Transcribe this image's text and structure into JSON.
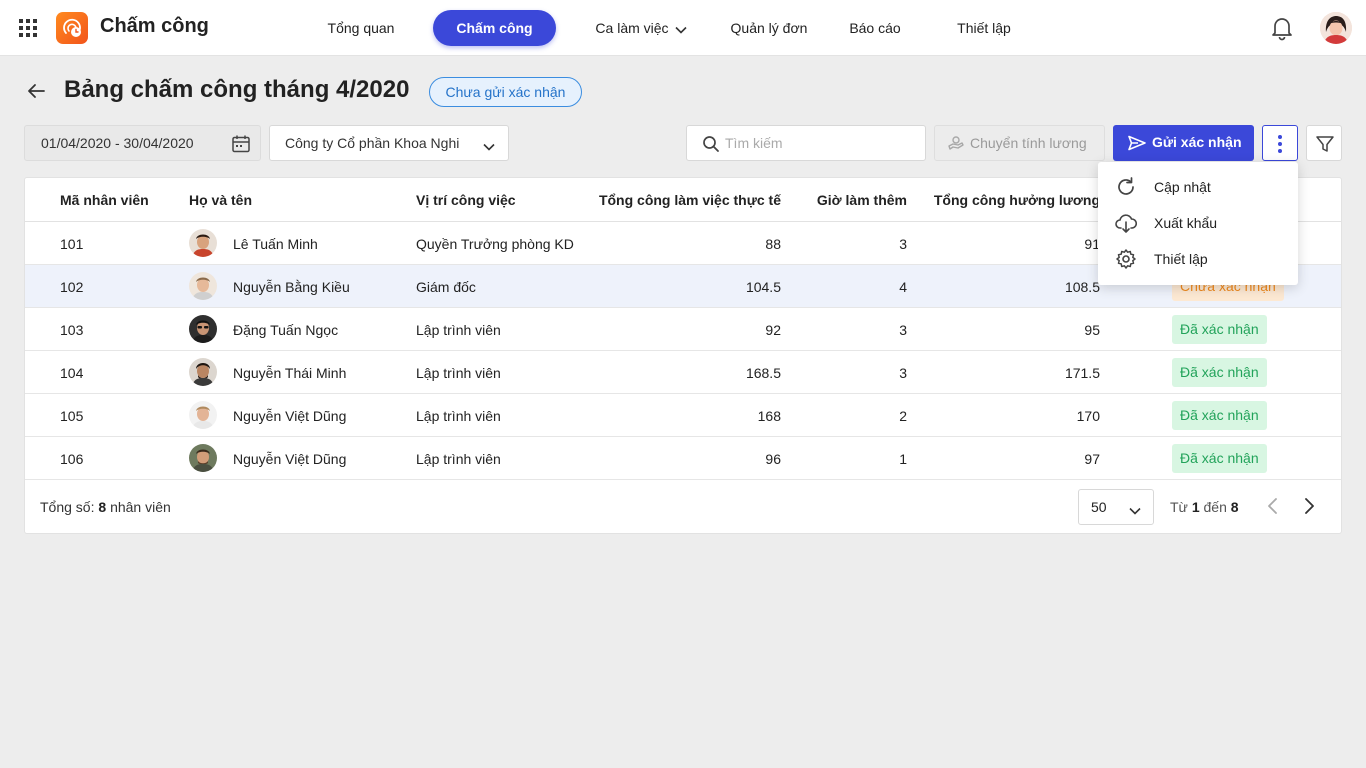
{
  "app": {
    "title": "Chấm công",
    "accent": "#3b48d9"
  },
  "nav": {
    "items": [
      {
        "label": "Tổng quan"
      },
      {
        "label": "Chấm công"
      },
      {
        "label": "Ca làm việc"
      },
      {
        "label": "Quản lý đơn"
      },
      {
        "label": "Báo cáo"
      },
      {
        "label": "Thiết lập"
      }
    ],
    "active": "Chấm công"
  },
  "header": {
    "title": "Bảng chấm công tháng 4/2020",
    "status": "Chưa gửi xác nhận"
  },
  "toolbar": {
    "date_range": "01/04/2020 - 30/04/2020",
    "company": "Công ty Cổ phần Khoa Nghi",
    "search_placeholder": "Tìm kiếm",
    "salary_label": "Chuyển tính lương",
    "send_label": "Gửi xác nhận"
  },
  "menu": {
    "items": [
      {
        "label": "Cập nhật",
        "icon": "refresh-icon"
      },
      {
        "label": "Xuất khẩu",
        "icon": "cloud-download-icon"
      },
      {
        "label": "Thiết lập",
        "icon": "gear-icon"
      }
    ]
  },
  "table": {
    "columns": [
      "Mã nhân viên",
      "Họ và tên",
      "Vị trí công việc",
      "Tổng công làm việc thực tế",
      "Giờ làm thêm",
      "Tổng công hưởng lương"
    ],
    "rows": [
      {
        "id": "101",
        "name": "Lê Tuấn Minh",
        "position": "Quyền Trưởng phòng KD",
        "actual": "88",
        "overtime": "3",
        "paid": "91",
        "status": ""
      },
      {
        "id": "102",
        "name": "Nguyễn Bằng Kiều",
        "position": "Giám đốc",
        "actual": "104.5",
        "overtime": "4",
        "paid": "108.5",
        "status": "Chưa xác nhận"
      },
      {
        "id": "103",
        "name": "Đặng Tuấn Ngọc",
        "position": "Lập trình viên",
        "actual": "92",
        "overtime": "3",
        "paid": "95",
        "status": "Đã xác nhận"
      },
      {
        "id": "104",
        "name": "Nguyễn Thái Minh",
        "position": "Lập trình viên",
        "actual": "168.5",
        "overtime": "3",
        "paid": "171.5",
        "status": "Đã xác nhận"
      },
      {
        "id": "105",
        "name": "Nguyễn Việt Dũng",
        "position": "Lập trình viên",
        "actual": "168",
        "overtime": "2",
        "paid": "170",
        "status": "Đã xác nhận"
      },
      {
        "id": "106",
        "name": "Nguyễn Việt Dũng",
        "position": "Lập trình viên",
        "actual": "96",
        "overtime": "1",
        "paid": "97",
        "status": "Đã xác nhận"
      }
    ]
  },
  "footer": {
    "total_prefix": "Tổng số:",
    "total_count": "8",
    "total_suffix": "nhân viên",
    "page_size": "50",
    "range_from_label": "Từ",
    "range_from": "1",
    "range_to_label": "đến",
    "range_to": "8"
  },
  "colors": {
    "confirmed_bg": "#d8f6e2",
    "confirmed_text": "#22a35a",
    "pending_bg": "#fde9d3",
    "pending_text": "#f08a1f"
  }
}
